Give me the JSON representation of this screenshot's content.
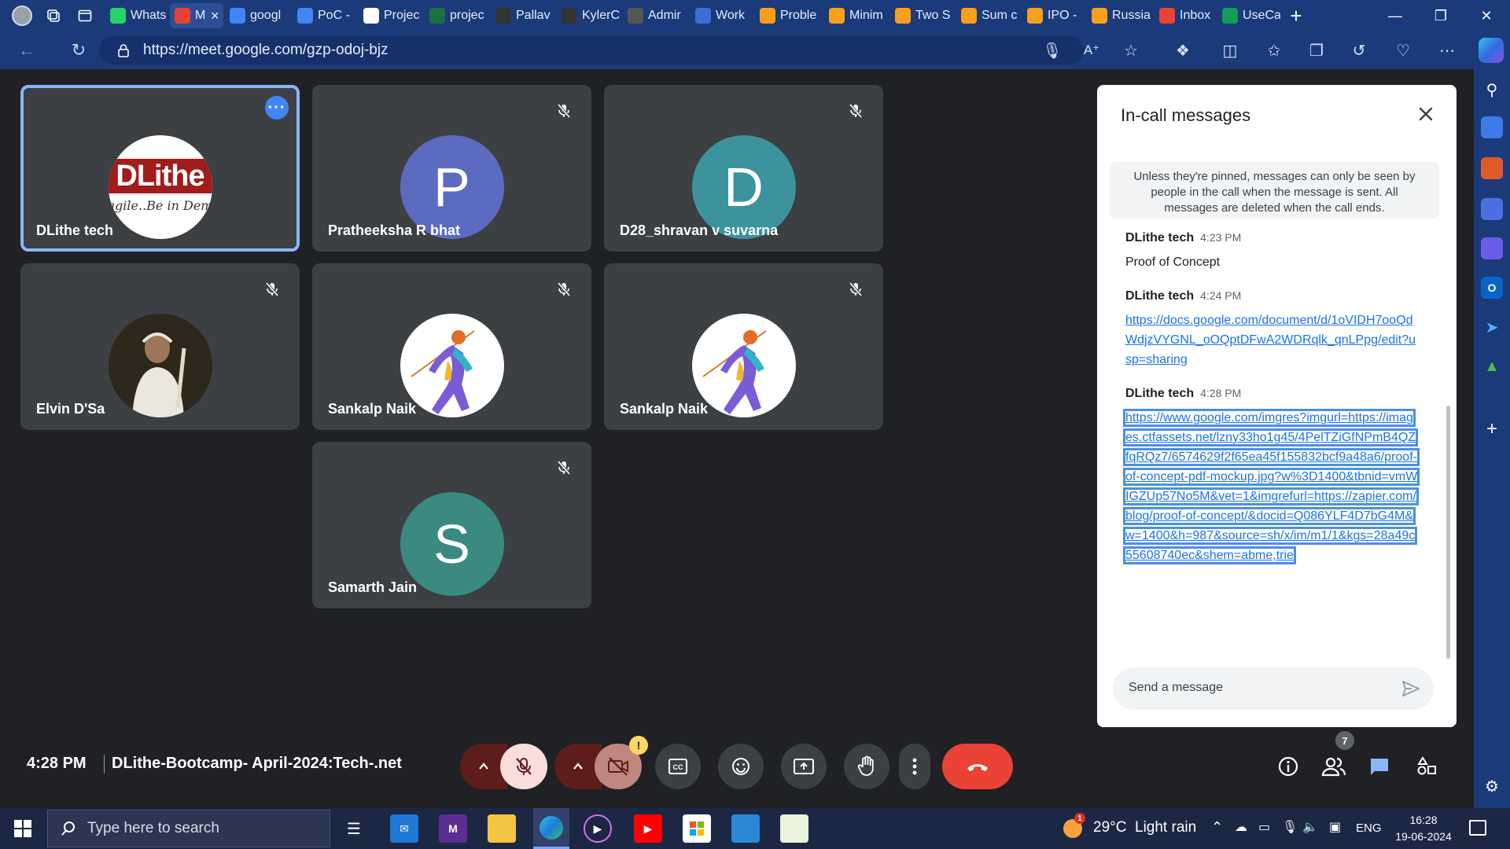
{
  "browser": {
    "tabs": [
      {
        "label": "Whats",
        "icon": "whatsapp-icon",
        "color": "#25d366"
      },
      {
        "label": "M",
        "icon": "recording-icon",
        "color": "#e94235",
        "active": true
      },
      {
        "label": "googl",
        "icon": "google-icon",
        "color": "#4285f4"
      },
      {
        "label": "PoC -",
        "icon": "docs-icon",
        "color": "#4285f4"
      },
      {
        "label": "Projec",
        "icon": "sheets-chart-icon",
        "color": "#ffffff"
      },
      {
        "label": "projec",
        "icon": "excel-icon",
        "color": "#1d6f42"
      },
      {
        "label": "Pallav",
        "icon": "github-icon",
        "color": "#333333"
      },
      {
        "label": "KylerC",
        "icon": "github-icon",
        "color": "#333333"
      },
      {
        "label": "Admir",
        "icon": "admin-icon",
        "color": "#555555"
      },
      {
        "label": "Work",
        "icon": "work-icon",
        "color": "#3a6fd8"
      },
      {
        "label": "Proble",
        "icon": "leetcode-icon",
        "color": "#f89f1b"
      },
      {
        "label": "Minim",
        "icon": "leetcode-icon",
        "color": "#f89f1b"
      },
      {
        "label": "Two S",
        "icon": "leetcode-icon",
        "color": "#f89f1b"
      },
      {
        "label": "Sum c",
        "icon": "leetcode-icon",
        "color": "#f89f1b"
      },
      {
        "label": "IPO -",
        "icon": "leetcode-icon",
        "color": "#f89f1b"
      },
      {
        "label": "Russia",
        "icon": "leetcode-icon",
        "color": "#f89f1b"
      },
      {
        "label": "Inbox",
        "icon": "gmail-icon",
        "color": "#ea4335"
      },
      {
        "label": "UseCa",
        "icon": "sheets-icon",
        "color": "#0f9d58"
      }
    ],
    "url": "https://meet.google.com/gzp-odoj-bjz"
  },
  "participants": [
    {
      "name": "DLithe tech",
      "avatar_type": "logo",
      "logo_text": "DLithe",
      "logo_tagline": "agile..Be in Dem",
      "muted": false,
      "active": true
    },
    {
      "name": "Pratheeksha R bhat",
      "avatar_type": "letter",
      "letter": "P",
      "color": "#5c6bc0",
      "muted": true
    },
    {
      "name": "D28_shravan v suvarna",
      "avatar_type": "letter",
      "letter": "D",
      "color": "#3c939e",
      "muted": true
    },
    {
      "name": "Elvin D'Sa",
      "avatar_type": "photo",
      "muted": true
    },
    {
      "name": "Sankalp Naik",
      "avatar_type": "athlete",
      "muted": true
    },
    {
      "name": "Sankalp Naik",
      "avatar_type": "athlete",
      "muted": true
    },
    {
      "name": "Samarth Jain",
      "avatar_type": "letter",
      "letter": "S",
      "color": "#3a8a80",
      "muted": true
    }
  ],
  "chat": {
    "title": "In-call messages",
    "notice": "Unless they're pinned, messages can only be seen by people in the call when the message is sent. All messages are deleted when the call ends.",
    "messages": [
      {
        "sender": "DLithe tech",
        "time": "4:23 PM",
        "text": "Proof of Concept"
      },
      {
        "sender": "DLithe tech",
        "time": "4:24 PM",
        "text": "https://docs.google.com/document/d/1oVIDH7ooQdWdjzVYGNL_oOQptDFwA2WDRqlk_qnLPpg/edit?usp=sharing"
      },
      {
        "sender": "DLithe tech",
        "time": "4:28 PM",
        "text": "https://www.google.com/imgres?imgurl=https://images.ctfassets.net/lzny33ho1g45/4PelTZiGfNPmB4QZfqRQz7/6574629f2f65ea45f155832bcf9a48a6/proof-of-concept-pdf-mockup.jpg?w%3D1400&tbnid=vmWIGZUp57No5M&vet=1&imgrefurl=https://zapier.com/blog/proof-of-concept/&docid=Q086YLF4D7bG4M&w=1400&h=987&source=sh/x/im/m1/1&kgs=28a49c55608740ec&shem=abme,trie"
      }
    ],
    "input_placeholder": "Send a message"
  },
  "controls": {
    "time": "4:28 PM",
    "meeting_name": "DLithe-Bootcamp- April-2024:Tech-.net",
    "people_count": "7",
    "camera_warning": "!"
  },
  "taskbar": {
    "search_placeholder": "Type here to search",
    "weather": "29°C  Light rain",
    "weather_badge": "1",
    "language": "ENG",
    "time": "16:28",
    "date": "19-06-2024"
  },
  "colors": {
    "accent": "#8ab4f8",
    "hangup": "#ea4335",
    "muted_btn": "#f9dedc",
    "link": "#1a73e8"
  }
}
